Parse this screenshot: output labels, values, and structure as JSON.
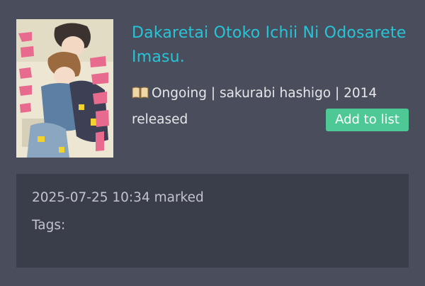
{
  "manga": {
    "title": "Dakaretai Otoko Ichii Ni Odosarete Imasu.",
    "status_line": "Ongoing | sakurabi hashigo | 2014",
    "released_label": "released",
    "add_button_label": "Add to list",
    "cover_icon": "book-icon"
  },
  "details": {
    "marked_text": "2025-07-25 10:34 marked",
    "tags_label": "Tags:"
  },
  "colors": {
    "background": "#4a4e5c",
    "panel": "#3a3d4a",
    "title": "#27c4d8",
    "button": "#4ec996"
  }
}
